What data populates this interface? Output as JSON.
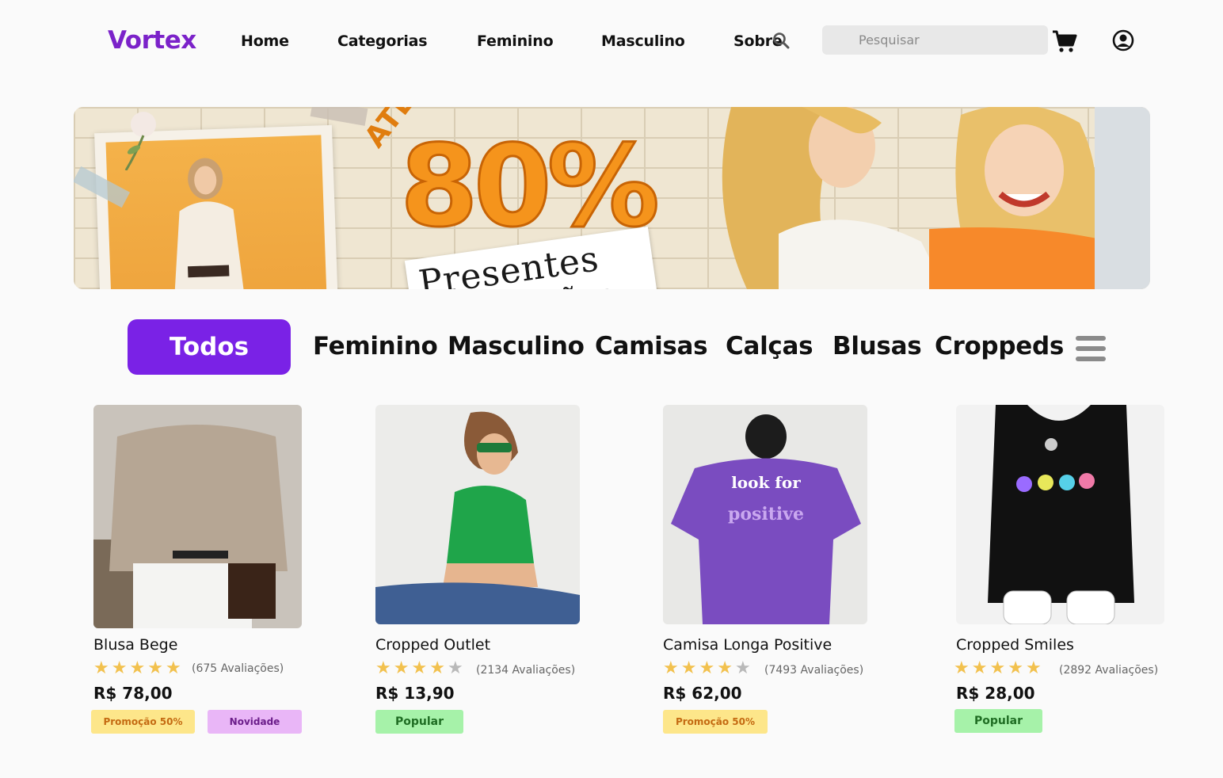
{
  "brand": {
    "name": "Vortex",
    "color": "#7b22c9"
  },
  "nav": {
    "items": [
      "Home",
      "Categorias",
      "Feminino",
      "Masculino",
      "Sobre"
    ]
  },
  "search": {
    "placeholder": "Pesquisar"
  },
  "banner": {
    "up_to": "ATÉ",
    "discount": "80%",
    "line1": "Presentes",
    "line2": "mães"
  },
  "categories": {
    "active": "Todos",
    "items": [
      "Feminino",
      "Masculino",
      "Camisas",
      "Calças",
      "Blusas",
      "Croppeds"
    ],
    "accent": "#7a22e6"
  },
  "products": [
    {
      "name": "Blusa Bege",
      "rating": 5,
      "reviews": "(675 Avaliações)",
      "price": "R$ 78,00",
      "badges": [
        "Promoção  50%",
        "Novidade"
      ]
    },
    {
      "name": "Cropped Outlet",
      "rating": 4,
      "reviews": "(2134 Avaliações)",
      "price": "R$ 13,90",
      "badges": [
        "Popular"
      ]
    },
    {
      "name": "Camisa Longa Positive",
      "rating": 4,
      "reviews": "(7493 Avaliações)",
      "price": "R$ 62,00",
      "badges": [
        "Promoção  50%"
      ]
    },
    {
      "name": "Cropped Smiles",
      "rating": 5,
      "reviews": "(2892 Avaliações)",
      "price": "R$ 28,00",
      "badges": [
        "Popular"
      ]
    }
  ],
  "colors": {
    "star_filled": "#f2c14e",
    "star_empty": "#b9b9b9"
  },
  "icons": [
    "search-icon",
    "cart-icon",
    "user-icon",
    "menu-icon"
  ]
}
